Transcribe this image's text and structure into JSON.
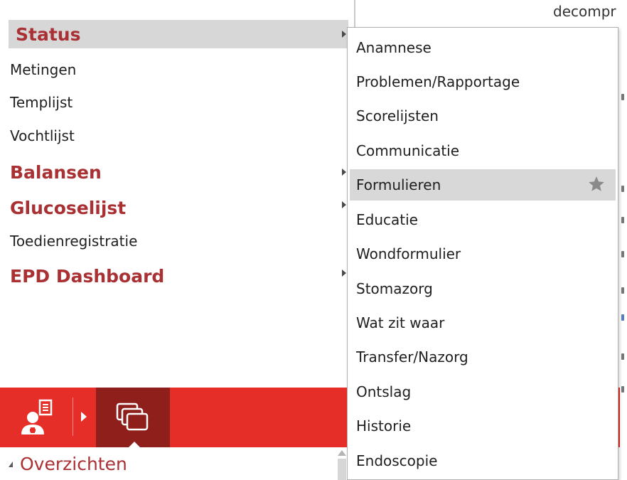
{
  "background": {
    "clipped_text": "decompr"
  },
  "left_menu": {
    "items": [
      {
        "label": "Status",
        "style": "heading",
        "highlighted": true,
        "has_submenu": true
      },
      {
        "label": "Metingen",
        "style": "normal"
      },
      {
        "label": "Templijst",
        "style": "normal"
      },
      {
        "label": "Vochtlijst",
        "style": "normal"
      },
      {
        "label": "Balansen",
        "style": "heading",
        "has_submenu": true
      },
      {
        "label": "Glucoselijst",
        "style": "heading",
        "has_submenu": true
      },
      {
        "label": "Toedienregistratie",
        "style": "normal"
      },
      {
        "label": "EPD Dashboard",
        "style": "heading",
        "has_submenu": true
      }
    ]
  },
  "submenu": {
    "items": [
      {
        "label": "Anamnese"
      },
      {
        "label": "Problemen/Rapportage"
      },
      {
        "label": "Scorelijsten"
      },
      {
        "label": "Communicatie"
      },
      {
        "label": "Formulieren",
        "highlighted": true,
        "icon": "star-icon"
      },
      {
        "label": "Educatie"
      },
      {
        "label": "Wondformulier"
      },
      {
        "label": "Stomazorg"
      },
      {
        "label": "Wat zit waar"
      },
      {
        "label": "Transfer/Nazorg"
      },
      {
        "label": "Ontslag"
      },
      {
        "label": "Historie"
      },
      {
        "label": "Endoscopie"
      }
    ]
  },
  "toolbar": {
    "buttons": [
      {
        "icon": "patient-record-icon"
      },
      {
        "icon": "windows-stack-icon",
        "active": true
      }
    ]
  },
  "panel": {
    "overzichten_label": "Overzichten"
  },
  "colors": {
    "accent_red": "#e52e27",
    "dark_red": "#8e1f1b",
    "heading_red": "#a93134",
    "highlight_gray": "#d7d7d7"
  }
}
